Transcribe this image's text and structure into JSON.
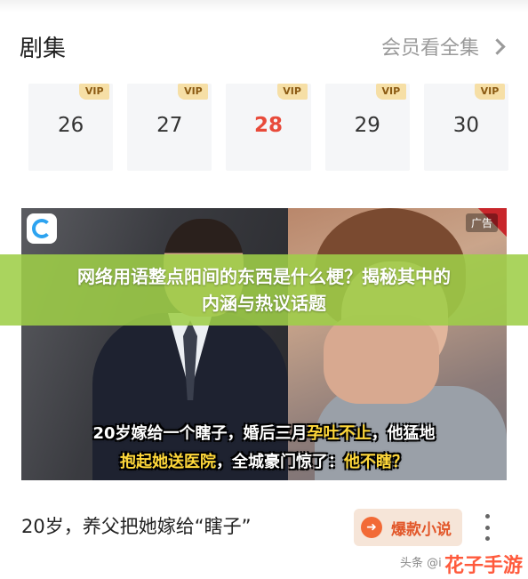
{
  "header": {
    "title": "剧集",
    "more_label": "会员看全集"
  },
  "episodes": [
    {
      "num": "26",
      "badge": "VIP"
    },
    {
      "num": "27",
      "badge": "VIP"
    },
    {
      "num": "28",
      "badge": "VIP",
      "active": true
    },
    {
      "num": "29",
      "badge": "VIP"
    },
    {
      "num": "30",
      "badge": "VIP"
    }
  ],
  "banner": {
    "ad_tag": "广告",
    "subtitle_line1_a": "20岁嫁给一个瞎子，婚后三月",
    "subtitle_line1_b": "孕吐不止",
    "subtitle_line1_c": "，他猛地",
    "subtitle_line2_a": "抱起她送医院",
    "subtitle_line2_b": "，全城豪门惊了：",
    "subtitle_line2_c": "他不瞎？"
  },
  "overlay": {
    "line1": "网络用语整点阳间的东西是什么梗？揭秘其中的",
    "line2": "内涵与热议话题"
  },
  "feed": {
    "title": "20岁，养父把她嫁给“瞎子”",
    "cta_label": "爆款小说"
  },
  "footer": {
    "source": "头条 @i",
    "watermark": "花子手游"
  },
  "colors": {
    "accent_red": "#e84a3a",
    "vip_gold": "#f6dfa6",
    "overlay_green": "#9ece48",
    "cta_orange": "#f26a36"
  }
}
